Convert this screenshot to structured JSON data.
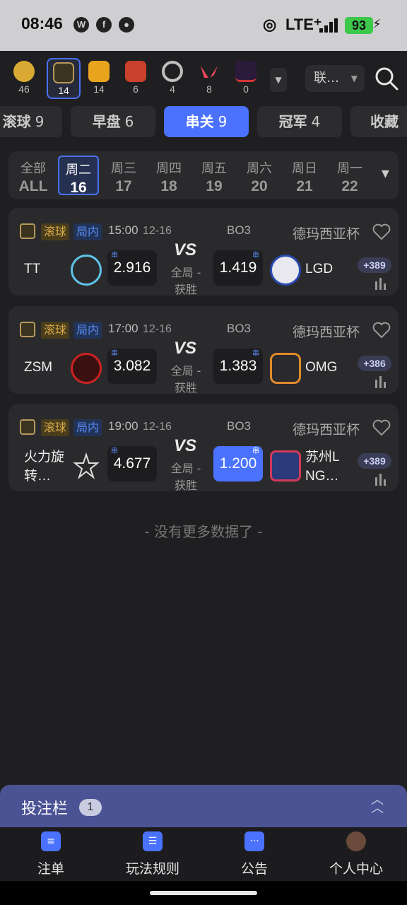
{
  "status_bar": {
    "time": "08:46",
    "network": "LTE⁺",
    "battery": "93"
  },
  "games": [
    {
      "name": "clover",
      "count": "46",
      "color": "#d9a933"
    },
    {
      "name": "league-of-legends",
      "count": "14",
      "color": "#b59a5b"
    },
    {
      "name": "counter-strike",
      "count": "14",
      "color": "#e8a41d"
    },
    {
      "name": "dota",
      "count": "6",
      "color": "#c9412a"
    },
    {
      "name": "overwatch",
      "count": "4",
      "color": "#bfbfbf"
    },
    {
      "name": "valorant",
      "count": "8",
      "color": "#f0475c"
    },
    {
      "name": "king-of-fighters",
      "count": "0",
      "color": "#d33434"
    }
  ],
  "language": "联…",
  "tabs": [
    {
      "label": "滚球",
      "count": "9"
    },
    {
      "label": "早盘",
      "count": "6"
    },
    {
      "label": "串关",
      "count": "9"
    },
    {
      "label": "冠军",
      "count": "4"
    },
    {
      "label": "收藏",
      "count": ""
    }
  ],
  "days": [
    {
      "name": "全部",
      "date": "ALL"
    },
    {
      "name": "周二",
      "date": "16"
    },
    {
      "name": "周三",
      "date": "17"
    },
    {
      "name": "周四",
      "date": "18"
    },
    {
      "name": "周五",
      "date": "19"
    },
    {
      "name": "周六",
      "date": "20"
    },
    {
      "name": "周日",
      "date": "21"
    },
    {
      "name": "周一",
      "date": "22"
    }
  ],
  "matches": [
    {
      "live": "滚球",
      "inplay": "局内",
      "time": "15:00",
      "date": "12-16",
      "format": "BO3",
      "league": "德玛西亚杯",
      "team_a": "TT",
      "odd_a": "2.916",
      "vs": "VS",
      "market": "全局 - 获胜",
      "odd_b": "1.419",
      "team_b": "LGD",
      "more": "+389",
      "tag": "串"
    },
    {
      "live": "滚球",
      "inplay": "局内",
      "time": "17:00",
      "date": "12-16",
      "format": "BO3",
      "league": "德玛西亚杯",
      "team_a": "ZSM",
      "odd_a": "3.082",
      "vs": "VS",
      "market": "全局 - 获胜",
      "odd_b": "1.383",
      "team_b": "OMG",
      "more": "+386",
      "tag": "串"
    },
    {
      "live": "滚球",
      "inplay": "局内",
      "time": "19:00",
      "date": "12-16",
      "format": "BO3",
      "league": "德玛西亚杯",
      "team_a": "火力旋转…",
      "odd_a": "4.677",
      "vs": "VS",
      "market": "全局 - 获胜",
      "odd_b": "1.200",
      "team_b": "苏州LNG…",
      "more": "+389",
      "tag": "串"
    }
  ],
  "no_more": "- 没有更多数据了 -",
  "bet_bar": {
    "label": "投注栏",
    "count": "1"
  },
  "nav": [
    {
      "label": "注单",
      "icon": "slip-icon"
    },
    {
      "label": "玩法规则",
      "icon": "rules-icon"
    },
    {
      "label": "公告",
      "icon": "notice-icon"
    },
    {
      "label": "个人中心",
      "icon": "avatar-icon"
    }
  ],
  "colors": {
    "accent": "#4a72ff",
    "live": "#d7a948",
    "inplay": "#5b8af5",
    "betbar": "#4b5395"
  }
}
